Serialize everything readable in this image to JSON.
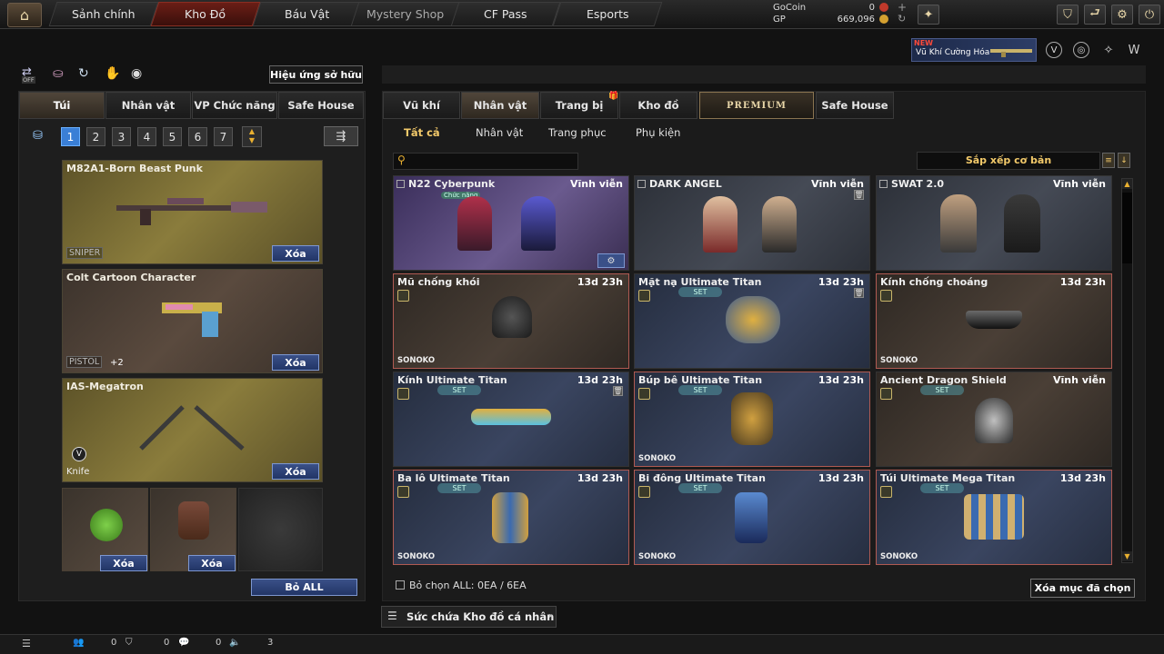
{
  "nav": {
    "tabs": [
      {
        "label": "Sảnh chính"
      },
      {
        "label": "Kho Đồ"
      },
      {
        "label": "Báu Vật"
      },
      {
        "label": "Mystery Shop"
      },
      {
        "label": "CF Pass"
      },
      {
        "label": "Esports"
      }
    ],
    "active_tab": "Kho Đồ"
  },
  "currency": {
    "gocoin_label": "GoCoin",
    "gocoin_value": "0",
    "gp_label": "GP",
    "gp_value": "669,096"
  },
  "promo": {
    "badge": "NEW",
    "text": "Vũ Khí Cường Hóa"
  },
  "left": {
    "effects_button": "Hiệu ứng sở hữu",
    "toggle_label": "OFF",
    "tabs": [
      {
        "label": "Túi"
      },
      {
        "label": "Nhân vật"
      },
      {
        "label": "VP Chức năng"
      },
      {
        "label": "Safe House"
      }
    ],
    "pages": [
      "1",
      "2",
      "3",
      "4",
      "5",
      "6",
      "7"
    ],
    "bag_items": [
      {
        "name": "M82A1-Born Beast Punk",
        "type": "SNIPER",
        "delete": "Xóa"
      },
      {
        "name": "Colt Cartoon Character",
        "type": "PISTOL",
        "extra": "+2",
        "delete": "Xóa"
      },
      {
        "name": "IAS-Megatron",
        "type": "Knife",
        "delete": "Xóa"
      }
    ],
    "small_delete": "Xóa",
    "clear_all": "Bỏ ALL"
  },
  "right": {
    "tabs": [
      {
        "label": "Vũ khí"
      },
      {
        "label": "Nhân vật"
      },
      {
        "label": "Trang bị"
      },
      {
        "label": "Kho đồ"
      },
      {
        "label": "PREMIUM"
      },
      {
        "label": "Safe House"
      }
    ],
    "subtabs": [
      {
        "label": "Tất cả"
      },
      {
        "label": "Nhân vật"
      },
      {
        "label": "Trang phục"
      },
      {
        "label": "Phụ kiện"
      }
    ],
    "sort_label": "Sắp xếp cơ bản",
    "items": [
      {
        "name": "N22 Cyberpunk",
        "duration": "Vĩnh viễn",
        "tag": "Chức năng"
      },
      {
        "name": "DARK ANGEL",
        "duration": "Vĩnh viễn"
      },
      {
        "name": "SWAT 2.0",
        "duration": "Vĩnh viễn"
      },
      {
        "name": "Mũ chống khói",
        "duration": "13d 23h",
        "sono": "SONOKO"
      },
      {
        "name": "Mặt nạ Ultimate Titan",
        "duration": "13d 23h",
        "set": "SET"
      },
      {
        "name": "Kính chống choáng",
        "duration": "13d 23h",
        "sono": "SONOKO"
      },
      {
        "name": "Kính Ultimate Titan",
        "duration": "13d 23h",
        "set": "SET"
      },
      {
        "name": "Búp bê Ultimate Titan",
        "duration": "13d 23h",
        "set": "SET",
        "sono": "SONOKO"
      },
      {
        "name": "Ancient Dragon Shield",
        "duration": "Vĩnh viễn",
        "set": "SET"
      },
      {
        "name": "Ba lô Ultimate Titan",
        "duration": "13d 23h",
        "set": "SET",
        "sono": "SONOKO"
      },
      {
        "name": "Bi đông Ultimate Titan",
        "duration": "13d 23h",
        "set": "SET",
        "sono": "SONOKO"
      },
      {
        "name": "Túi Ultimate Mega Titan",
        "duration": "13d 23h",
        "set": "SET",
        "sono": "SONOKO"
      }
    ],
    "select_all": "Bỏ chọn ALL: 0EA / 6EA",
    "delete_selected": "Xóa mục đã chọn",
    "capacity": "Sức chứa Kho đồ cá nhân"
  },
  "bottom": {
    "c1": "0",
    "c2": "0",
    "c3": "0",
    "c4": "3"
  }
}
